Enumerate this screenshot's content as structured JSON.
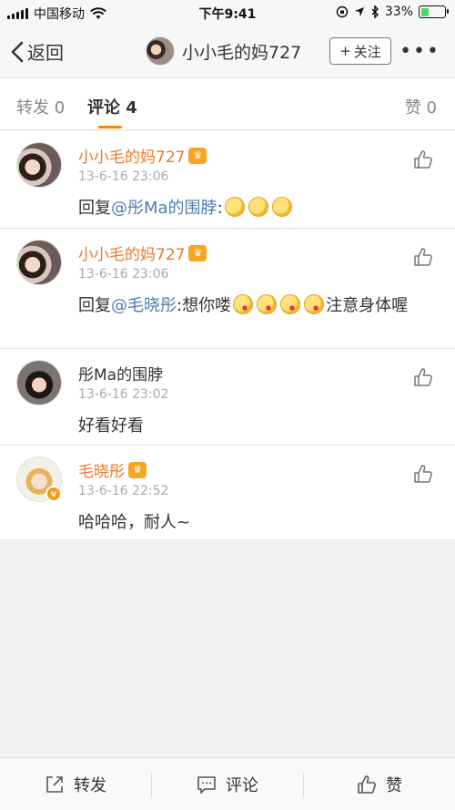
{
  "status_bar": {
    "carrier": "中国移动",
    "time": "下午9:41",
    "battery": "33%",
    "battery_level": 0.33
  },
  "nav": {
    "back_label": "返回",
    "title": "小小毛的妈727",
    "follow_label": "关注",
    "follow_plus": "+",
    "more": "•••"
  },
  "tabs": {
    "repost": "转发 0",
    "comment": "评论 4",
    "like": "赞 0"
  },
  "comments": [
    {
      "name": "小小毛的妈727",
      "time": "13-6-16 23:06",
      "reply_prefix": "回复",
      "mention": "@彤Ma的围脖",
      "text": ":",
      "emojis": 3
    },
    {
      "name": "小小毛的妈727",
      "time": "13-6-16 23:06",
      "reply_prefix": "回复",
      "mention": "@毛晓彤",
      "text": ":想你喽",
      "emojis": 4,
      "text_after": "注意身体喔"
    },
    {
      "name": "彤Ma的围脖",
      "time": "13-6-16 23:02",
      "text": "好看好看"
    },
    {
      "name": "毛晓彤",
      "time": "13-6-16 22:52",
      "text": "哈哈哈，耐人~",
      "vbadge": "v"
    }
  ],
  "bottom": {
    "repost": "转发",
    "comment": "评论",
    "like": "赞"
  },
  "colors": {
    "name_orange": "#e8792b",
    "mention_blue": "#507daf",
    "tab_underline": "#ff8200",
    "battery_green": "#4cd964"
  }
}
